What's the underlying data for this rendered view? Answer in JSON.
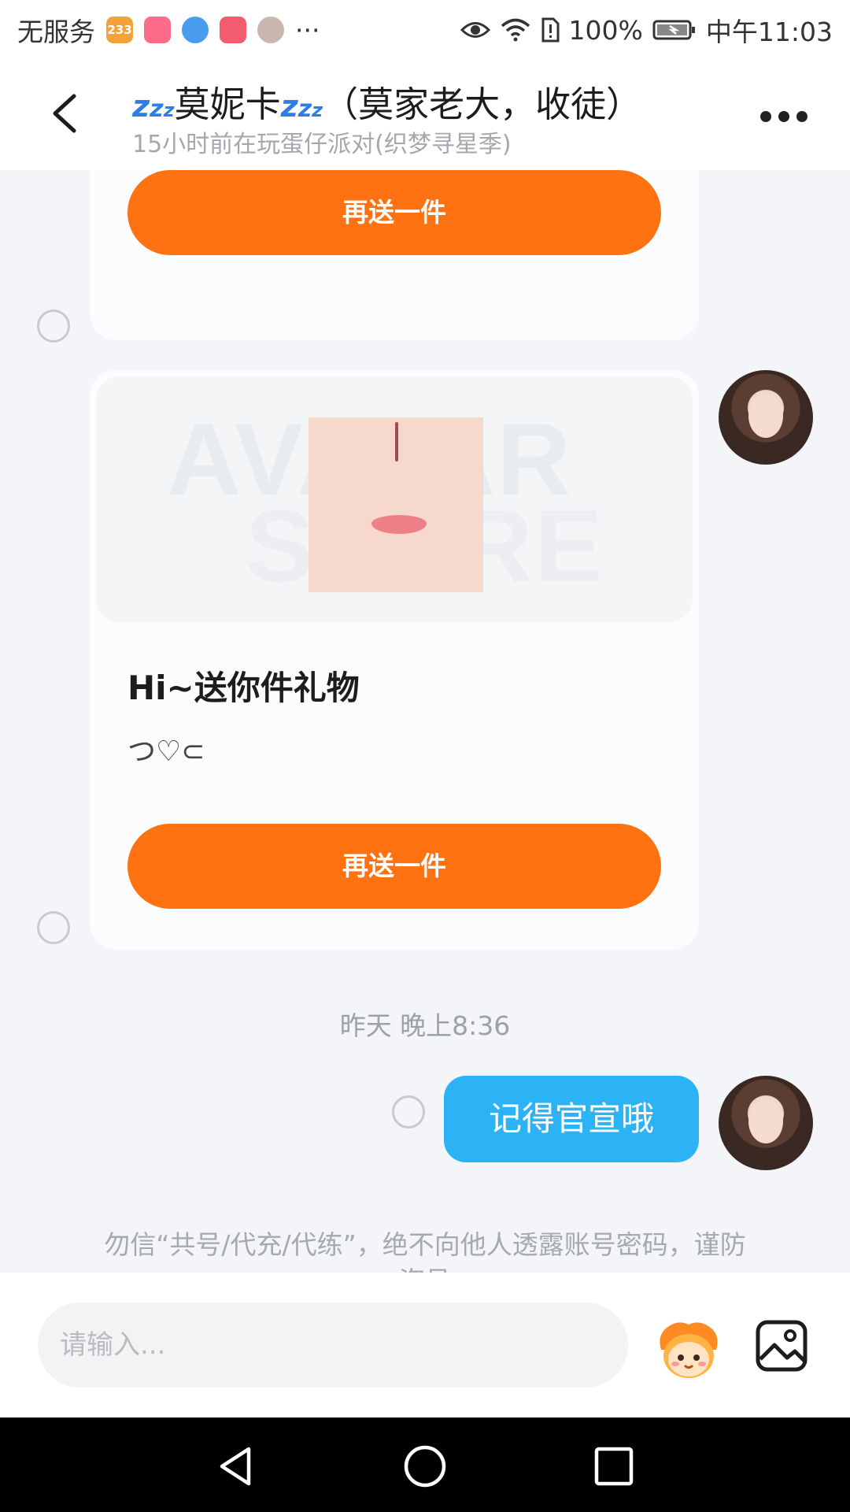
{
  "status_bar": {
    "carrier": "无服务",
    "app_233_label": "233",
    "battery": "100%",
    "time": "中午11:03",
    "more": "···"
  },
  "header": {
    "title_main": "莫妮卡",
    "title_suffix": "（莫家老大，收徒）",
    "zzz": "z",
    "subtitle": "15小时前在玩蛋仔派对(织梦寻星季)"
  },
  "messages": {
    "card1_button": "再送一件",
    "gift_title": "Hi~送你件礼物",
    "gift_subtitle": "つ♡⊂",
    "card2_button": "再送一件",
    "watermark_line1": "AVATAR",
    "watermark_line2": "STORE",
    "timestamp": "昨天 晚上8:36",
    "bubble_text": "记得官宣哦"
  },
  "notice": {
    "line1": "勿信“共号/代充/代练”，绝不向他人透露账号密码，谨防",
    "line2": "盗号"
  },
  "input": {
    "placeholder": "请输入..."
  },
  "colors": {
    "accent_orange": "#ff7212",
    "bubble_blue": "#2bb3f5",
    "zzz_blue": "#2f7ee6"
  }
}
